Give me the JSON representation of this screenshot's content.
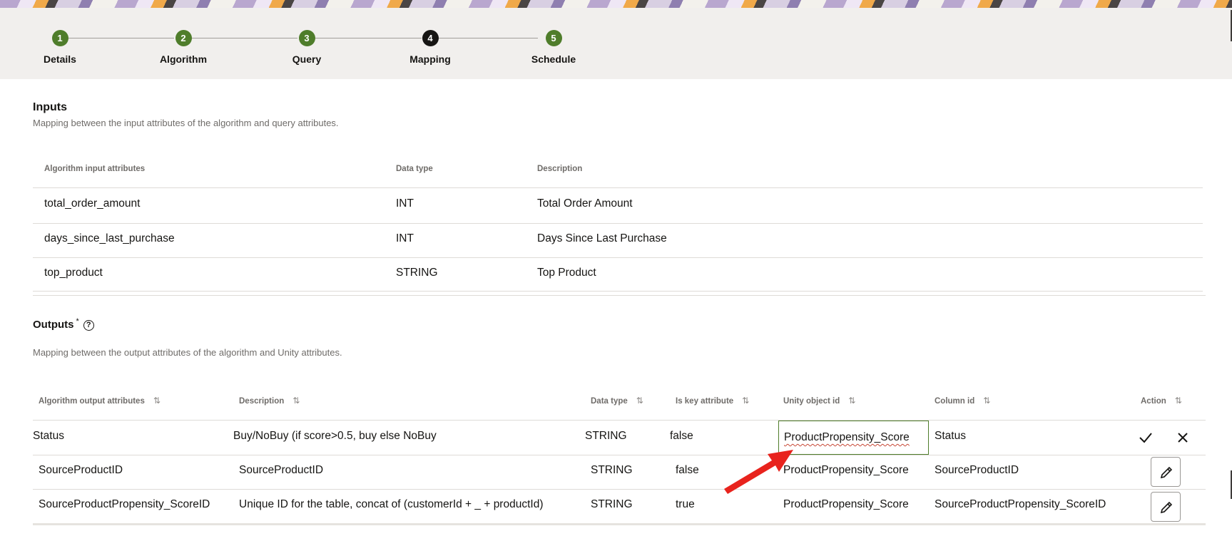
{
  "train": {
    "steps": [
      {
        "number": "1",
        "label": "Details"
      },
      {
        "number": "2",
        "label": "Algorithm"
      },
      {
        "number": "3",
        "label": "Query"
      },
      {
        "number": "4",
        "label": "Mapping"
      },
      {
        "number": "5",
        "label": "Schedule"
      }
    ]
  },
  "inputs": {
    "title": "Inputs",
    "description": "Mapping between the input attributes of the algorithm and query attributes.",
    "columns": [
      "Algorithm input attributes",
      "Data type",
      "Description"
    ],
    "rows": [
      [
        "total_order_amount",
        "INT",
        "Total Order Amount"
      ],
      [
        "days_since_last_purchase",
        "INT",
        "Days Since Last Purchase"
      ],
      [
        "top_product",
        "STRING",
        "Top Product"
      ]
    ]
  },
  "outputs": {
    "title": "Outputs",
    "required_mark": "*",
    "help_icon_glyph": "?",
    "description": "Mapping between the output attributes of the algorithm and Unity attributes.",
    "columns": [
      "Algorithm output attributes",
      "Description",
      "Data type",
      "Is key attribute",
      "Unity object id",
      "Column id",
      "Action"
    ],
    "sort_glyph": "⇅",
    "rows": [
      [
        "Status",
        "Buy/NoBuy (if score>0.5, buy else NoBuy",
        "STRING",
        "false",
        "ProductPropensity_Score",
        "Status"
      ],
      [
        "SourceProductID",
        "SourceProductID",
        "STRING",
        "false",
        "ProductPropensity_Score",
        "SourceProductID"
      ],
      [
        "SourceProductPropensity_ScoreID",
        "Unique ID for the table, concat of (customerId + _ + productId)",
        "STRING",
        "true",
        "ProductPropensity_Score",
        "SourceProductPropensity_ScoreID"
      ]
    ]
  },
  "colors": {
    "step_complete": "#4f7d2b",
    "step_current": "#161513",
    "arrow": "#e8231d",
    "spellcheck": "#c74634"
  },
  "icons": {
    "save": "checkmark-icon",
    "cancel": "close-icon",
    "edit": "pencil-icon",
    "annotation": "red-arrow-icon"
  }
}
